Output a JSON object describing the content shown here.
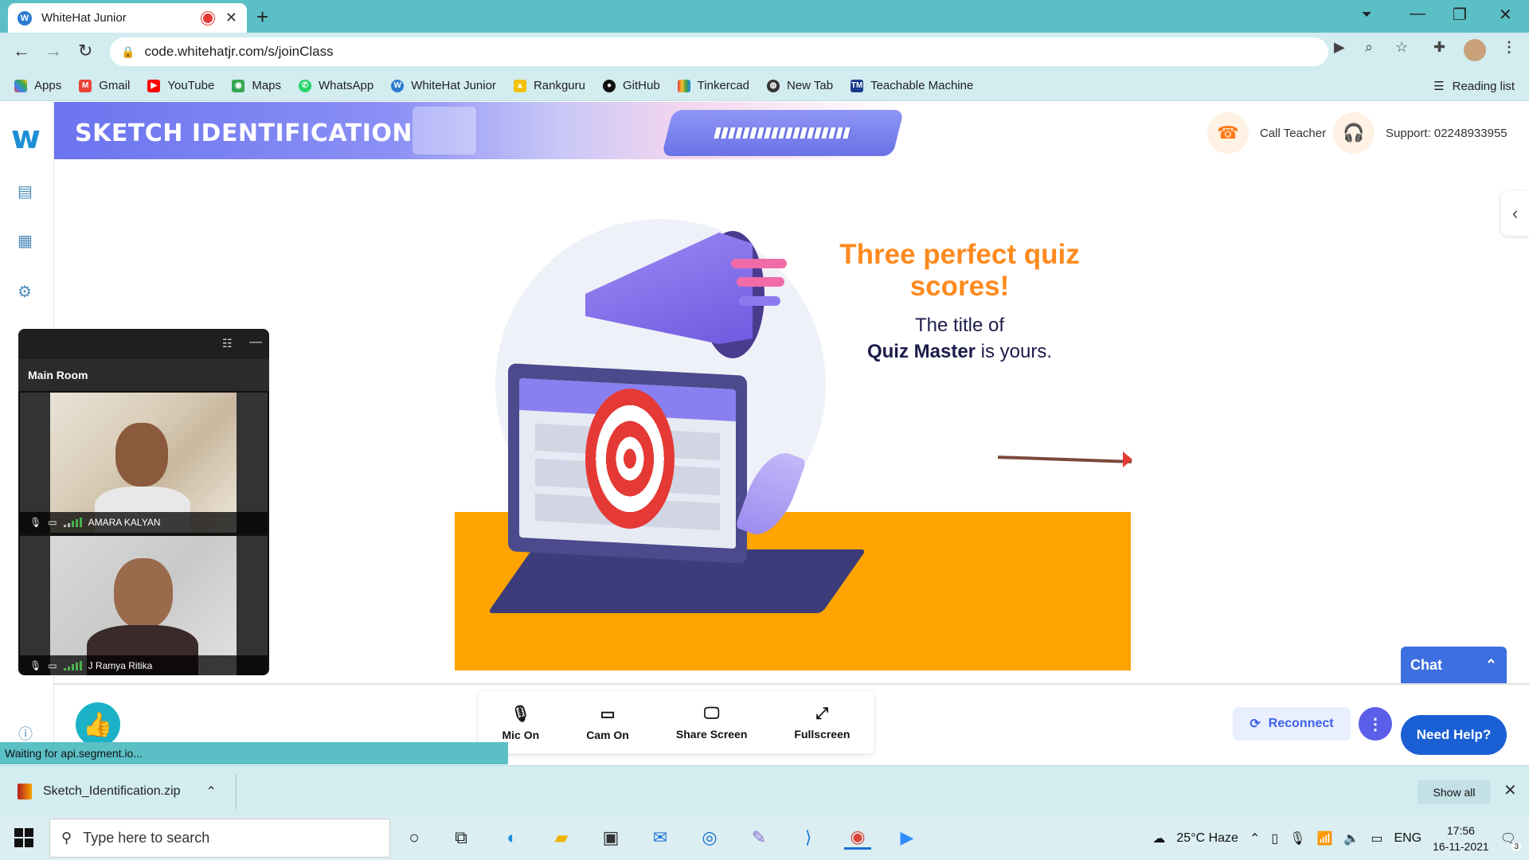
{
  "browser": {
    "tab_title": "WhiteHat Junior",
    "url": "code.whitehatjr.com/s/joinClass",
    "bookmarks": [
      "Apps",
      "Gmail",
      "YouTube",
      "Maps",
      "WhatsApp",
      "WhiteHat Junior",
      "Rankguru",
      "GitHub",
      "Tinkercad",
      "New Tab",
      "Teachable Machine"
    ],
    "reading_list": "Reading list"
  },
  "header": {
    "banner_title": "SKETCH IDENTIFICATION",
    "call_teacher": "Call Teacher",
    "support": "Support: 02248933955"
  },
  "main": {
    "headline": "Three perfect quiz scores!",
    "sub_line1": "The title of",
    "sub_bold": "Quiz Master",
    "sub_rest": " is yours."
  },
  "video": {
    "room": "Main Room",
    "participants": [
      {
        "name": "AMARA KALYAN"
      },
      {
        "name": "J Ramya Ritika"
      }
    ]
  },
  "controls": {
    "mic": "Mic On",
    "cam": "Cam On",
    "share": "Share Screen",
    "fullscreen": "Fullscreen",
    "reconnect": "Reconnect",
    "chat": "Chat",
    "need_help": "Need Help?"
  },
  "status_text": "Waiting for api.segment.io...",
  "download": {
    "file": "Sketch_Identification.zip",
    "show_all": "Show all"
  },
  "taskbar": {
    "search_placeholder": "Type here to search",
    "weather": "25°C  Haze",
    "lang": "ENG",
    "time": "17:56",
    "date": "16-11-2021",
    "notif_count": "3"
  },
  "colors": {
    "teal": "#5bbfc6",
    "accent_orange": "#ff8a1e",
    "stage_orange": "#ffa400",
    "primary_blue": "#1b5fd4"
  }
}
